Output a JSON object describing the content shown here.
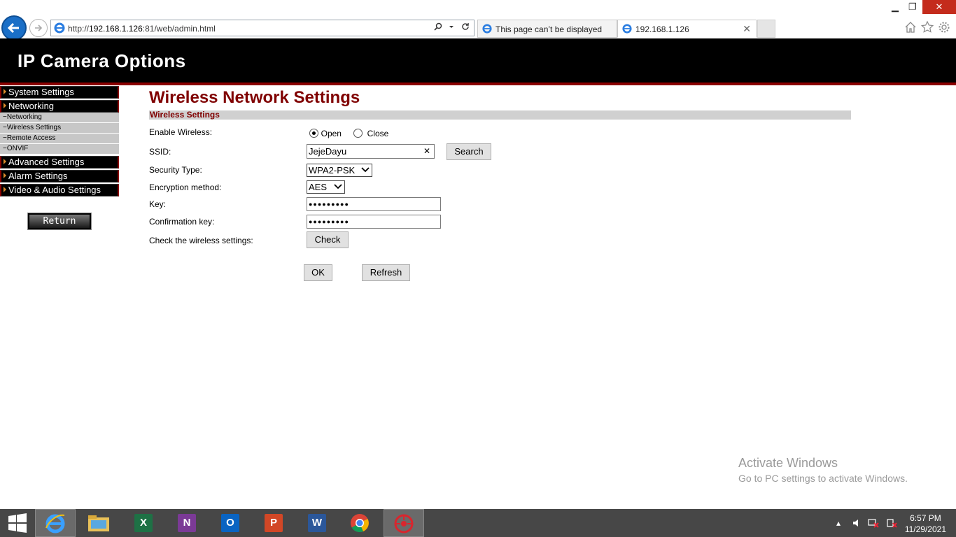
{
  "browser": {
    "url_prefix": "http://",
    "url_host": "192.168.1.126",
    "url_rest": ":81/web/admin.html",
    "tabs": [
      {
        "title": "This page can’t be displayed"
      },
      {
        "title": "192.168.1.126"
      }
    ],
    "icons": [
      "back-arrow-icon",
      "forward-arrow-icon",
      "ie-icon",
      "search-icon",
      "refresh-icon",
      "home-icon",
      "star-icon",
      "gear-icon"
    ]
  },
  "header": {
    "title": "IP Camera Options"
  },
  "sidebar": {
    "menu": [
      {
        "label": "System Settings"
      },
      {
        "label": "Networking"
      }
    ],
    "submenu": [
      {
        "label": "−Networking"
      },
      {
        "label": "−Wireless Settings"
      },
      {
        "label": "−Remote Access"
      },
      {
        "label": "−ONVIF"
      }
    ],
    "menu2": [
      {
        "label": "Advanced Settings"
      },
      {
        "label": "Alarm Settings"
      },
      {
        "label": "Video & Audio Settings"
      }
    ],
    "return_label": "Return"
  },
  "main": {
    "title": "Wireless Network Settings",
    "section": "Wireless Settings",
    "enable_label": "Enable Wireless:",
    "open_label": "Open",
    "close_label": "Close",
    "ssid_label": "SSID:",
    "ssid_value": "JejeDayu",
    "search_label": "Search",
    "security_label": "Security Type:",
    "security_value": "WPA2-PSK",
    "encryption_label": "Encryption method:",
    "encryption_value": "AES",
    "key_label": "Key:",
    "key_value": "●●●●●●●●●",
    "confirm_label": "Confirmation key:",
    "confirm_value": "●●●●●●●●●",
    "check_label": "Check the wireless settings:",
    "check_button": "Check",
    "ok_button": "OK",
    "refresh_button": "Refresh"
  },
  "watermark": {
    "line1": "Activate Windows",
    "line2": "Go to PC settings to activate Windows."
  },
  "taskbar": {
    "time": "6:57 PM",
    "date": "11/29/2021",
    "apps": [
      "windows-start-icon",
      "internet-explorer-icon",
      "file-explorer-icon",
      "excel-icon",
      "onenote-icon",
      "outlook-icon",
      "powerpoint-icon",
      "word-icon",
      "chrome-icon",
      "camera-app-icon"
    ]
  },
  "colors": {
    "accent": "#800000",
    "header_bg": "#000000",
    "section_bg": "#d0d0d0"
  }
}
